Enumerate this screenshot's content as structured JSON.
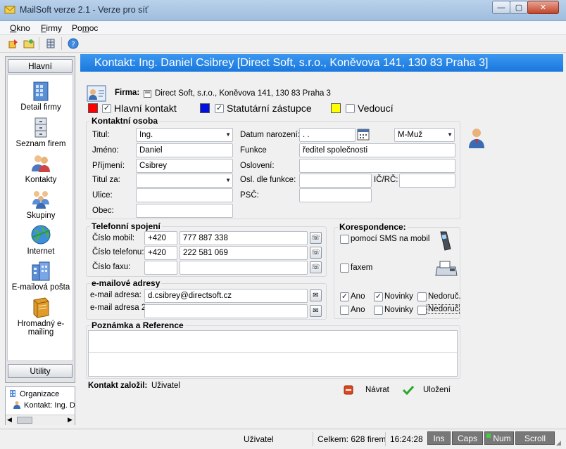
{
  "window": {
    "title": "MailSoft verze 2.1 - Verze pro síť",
    "minimize": "—",
    "maximize": "▢",
    "close": "✕"
  },
  "menu": {
    "items": [
      {
        "label": "Okno",
        "mnemonic": "O"
      },
      {
        "label": "Firmy",
        "mnemonic": "F"
      },
      {
        "label": "Pomoc",
        "mnemonic": "m"
      }
    ]
  },
  "toolbar": {
    "icons": [
      "exit-icon",
      "folder-icon",
      "grid-icon",
      "help-icon"
    ]
  },
  "left_panel": {
    "header": "Hlavní",
    "footer": "Utility",
    "items": [
      {
        "label": "Detail firmy",
        "icon": "building-icon"
      },
      {
        "label": "Seznam firem",
        "icon": "cabinet-icon"
      },
      {
        "label": "Kontakty",
        "icon": "contacts-icon"
      },
      {
        "label": "Skupiny",
        "icon": "groups-icon"
      },
      {
        "label": "Internet",
        "icon": "globe-icon"
      },
      {
        "label": "E-mailová pošta",
        "icon": "mail-building-icon"
      },
      {
        "label": "Hromadný e-mailing",
        "icon": "book-icon"
      }
    ]
  },
  "tree": {
    "items": [
      "Organizace",
      "Kontakt: Ing. D"
    ]
  },
  "header": {
    "title": "Kontakt: Ing. Daniel Csibrey [Direct Soft, s.r.o., Koněvova 141, 130 83 Praha 3]"
  },
  "firm": {
    "label": "Firma:",
    "value": "Direct Soft, s.r.o., Koněvova 141, 130 83 Praha 3"
  },
  "flags": [
    {
      "label": "Hlavní kontakt",
      "color": "#ff0000",
      "checked": true,
      "check": "✓"
    },
    {
      "label": "Statutární zástupce",
      "color": "#0010e0",
      "checked": true,
      "check": "✓"
    },
    {
      "label": "Vedoucí",
      "color": "#ffff00",
      "checked": false,
      "check": ""
    }
  ],
  "contact_person": {
    "title": "Kontaktní osoba",
    "titul_label": "Titul:",
    "titul_value": "Ing.",
    "jmeno_label": "Jméno:",
    "jmeno_value": "Daniel",
    "prijmeni_label": "Příjmení:",
    "prijmeni_value": "Csibrey",
    "titul_za_label": "Titul za:",
    "titul_za_value": "",
    "ulice_label": "Ulice:",
    "ulice_value": "",
    "obec_label": "Obec:",
    "obec_value": "",
    "datum_label": "Datum narození:",
    "datum_value": " .  .",
    "pohlavi_value": "M-Muž",
    "funkce_label": "Funkce",
    "funkce_value": "ředitel společnosti",
    "osloveni_label": "Oslovení:",
    "osloveni_value": "",
    "osl_label": "Osl. dle funkce:",
    "osl_value": "",
    "ic_label": "IČ/RČ:",
    "ic_value": "",
    "psc_label": "PSČ:",
    "psc_value": ""
  },
  "phones": {
    "title": "Telefonní spojení",
    "mobil_label": "Číslo mobil:",
    "mobil_prefix": "+420",
    "mobil_value": "777 887 338",
    "telefon_label": "Číslo telefonu:",
    "telefon_prefix": "+420",
    "telefon_value": "222 581 069",
    "fax_label": "Číslo faxu:",
    "fax_prefix": "",
    "fax_value": ""
  },
  "emails": {
    "title": "e-mailové adresy",
    "email1_label": "e-mail adresa:",
    "email1_value": "d.csibrey@directsoft.cz",
    "email2_label": "e-mail adresa 2:",
    "email2_value": ""
  },
  "correspondence": {
    "title": "Korespondence:",
    "sms_label": "pomocí SMS na mobil",
    "fax_label": "faxem",
    "row1": [
      {
        "label": "Ano",
        "check": "✓"
      },
      {
        "label": "Novinky",
        "check": "✓"
      },
      {
        "label": "Nedoruč.",
        "check": ""
      }
    ],
    "row2": [
      {
        "label": "Ano",
        "check": ""
      },
      {
        "label": "Novinky",
        "check": ""
      },
      {
        "label": "Nedoruč",
        "check": ""
      }
    ]
  },
  "notes": {
    "title": "Poznámka a Reference"
  },
  "footer": {
    "created_label": "Kontakt založil:",
    "created_value": "Uživatel",
    "back_label": "Návrat",
    "save_label": "Uložení"
  },
  "status": {
    "user": "Uživatel",
    "total": "Celkem: 628 firem",
    "time": "16:24:28",
    "ins": "Ins",
    "caps": "Caps",
    "num": "Num",
    "scroll": "Scroll"
  },
  "colors": {
    "header_blue": "#1a78de",
    "num_indicator": "#3fd23f"
  }
}
